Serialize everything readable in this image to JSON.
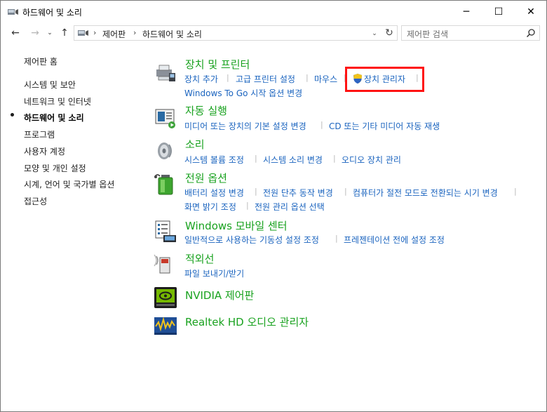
{
  "window": {
    "title": "하드웨어 및 소리",
    "min_label": "─",
    "max_label": "☐",
    "close_label": "✕"
  },
  "nav": {
    "back": "←",
    "forward": "→",
    "recent": "⌄",
    "up": "↑",
    "breadcrumb": [
      "제어판",
      "하드웨어 및 소리"
    ],
    "breadcrumb_sep": "›",
    "dropdown": "⌄",
    "refresh": "↻"
  },
  "search": {
    "placeholder": "제어판 검색"
  },
  "sidebar": {
    "items": [
      {
        "label": "제어판 홈"
      },
      {
        "label": "시스템 및 보안"
      },
      {
        "label": "네트워크 및 인터넷"
      },
      {
        "label": "하드웨어 및 소리",
        "current": true
      },
      {
        "label": "프로그램"
      },
      {
        "label": "사용자 계정"
      },
      {
        "label": "모양 및 개인 설정"
      },
      {
        "label": "시계, 언어 및 국가별 옵션"
      },
      {
        "label": "접근성"
      }
    ]
  },
  "categories": [
    {
      "title": "장치 및 프린터",
      "icon": "printer-icon",
      "links": [
        "장치 추가",
        "고급 프린터 설정",
        "마우스",
        "장치 관리자",
        "Windows To Go 시작 옵션 변경"
      ]
    },
    {
      "title": "자동 실행",
      "icon": "autoplay-icon",
      "links": [
        "미디어 또는 장치의 기본 설정 변경",
        "CD 또는 기타 미디어 자동 재생"
      ]
    },
    {
      "title": "소리",
      "icon": "speaker-icon",
      "links": [
        "시스템 볼륨 조정",
        "시스템 소리 변경",
        "오디오 장치 관리"
      ]
    },
    {
      "title": "전원 옵션",
      "icon": "battery-icon",
      "links": [
        "배터리 설정 변경",
        "전원 단추 동작 변경",
        "컴퓨터가 절전 모드로 전환되는 시기 변경",
        "화면 밝기 조정",
        "전원 관리 옵션 선택"
      ]
    },
    {
      "title": "Windows 모바일 센터",
      "icon": "mobility-center-icon",
      "links": [
        "일반적으로 사용하는 기동성 설정 조정",
        "프레젠테이션 전에 설정 조정"
      ]
    },
    {
      "title": "적외선",
      "icon": "infrared-icon",
      "links": [
        "파일 보내기/받기"
      ]
    },
    {
      "title": "NVIDIA 제어판",
      "icon": "nvidia-icon",
      "links": []
    },
    {
      "title": "Realtek HD 오디오 관리자",
      "icon": "realtek-audio-icon",
      "links": []
    }
  ],
  "colors": {
    "category_title": "#19a21f",
    "link": "#1b64bf",
    "highlight_box": "#ff1313"
  }
}
